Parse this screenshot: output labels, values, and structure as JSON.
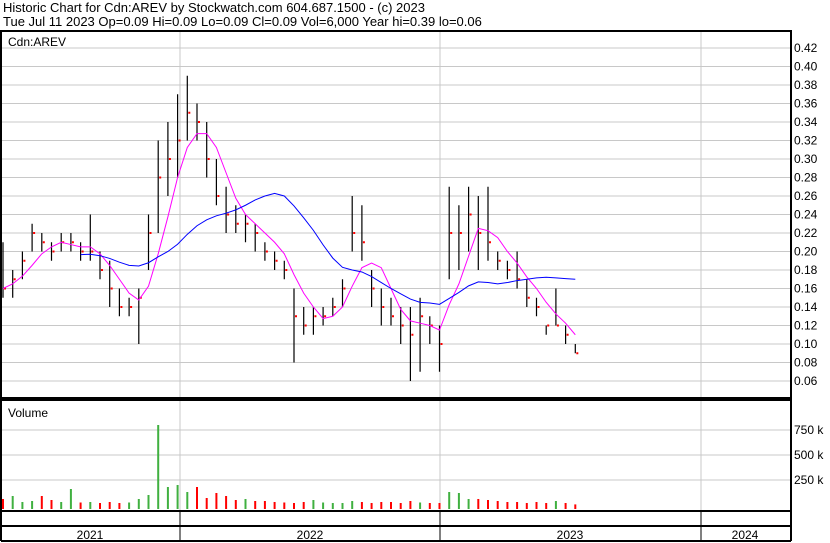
{
  "header": {
    "line1": "Historic Chart for Cdn:AREV by Stockwatch.com 604.687.1500 - (c) 2023",
    "line2": "Tue Jul 11 2023  Op=0.09  Hi=0.09  Lo=0.09  Cl=0.09  Vol=6,000  Year hi=0.39  lo=0.06"
  },
  "chart_data": {
    "type": "line",
    "title": "Cdn:AREV",
    "volume_label": "Volume",
    "price_ticks": [
      "0.42",
      "0.40",
      "0.38",
      "0.36",
      "0.34",
      "0.32",
      "0.30",
      "0.28",
      "0.26",
      "0.24",
      "0.22",
      "0.20",
      "0.18",
      "0.16",
      "0.14",
      "0.12",
      "0.10",
      "0.08",
      "0.06"
    ],
    "ylim": [
      0.045,
      0.435
    ],
    "volume_ticks": [
      "750 k",
      "500 k",
      "250 k"
    ],
    "years": [
      "2021",
      "2022",
      "2023",
      "2024"
    ],
    "bars": [
      [
        0.21,
        0.15,
        0.16
      ],
      [
        0.18,
        0.15,
        0.17
      ],
      [
        0.2,
        0.17,
        0.19
      ],
      [
        0.23,
        0.2,
        0.22
      ],
      [
        0.22,
        0.2,
        0.21
      ],
      [
        0.21,
        0.19,
        0.2
      ],
      [
        0.22,
        0.2,
        0.21
      ],
      [
        0.22,
        0.2,
        0.21
      ],
      [
        0.21,
        0.19,
        0.2
      ],
      [
        0.24,
        0.19,
        0.2
      ],
      [
        0.2,
        0.17,
        0.18
      ],
      [
        0.19,
        0.14,
        0.16
      ],
      [
        0.16,
        0.13,
        0.14
      ],
      [
        0.15,
        0.13,
        0.14
      ],
      [
        0.16,
        0.1,
        0.15
      ],
      [
        0.24,
        0.18,
        0.22
      ],
      [
        0.32,
        0.22,
        0.28
      ],
      [
        0.34,
        0.26,
        0.3
      ],
      [
        0.37,
        0.28,
        0.32
      ],
      [
        0.39,
        0.32,
        0.35
      ],
      [
        0.36,
        0.32,
        0.34
      ],
      [
        0.34,
        0.28,
        0.3
      ],
      [
        0.3,
        0.25,
        0.26
      ],
      [
        0.27,
        0.22,
        0.24
      ],
      [
        0.25,
        0.22,
        0.23
      ],
      [
        0.24,
        0.21,
        0.23
      ],
      [
        0.23,
        0.2,
        0.22
      ],
      [
        0.21,
        0.19,
        0.2
      ],
      [
        0.2,
        0.18,
        0.19
      ],
      [
        0.19,
        0.17,
        0.18
      ],
      [
        0.16,
        0.08,
        0.13
      ],
      [
        0.14,
        0.11,
        0.12
      ],
      [
        0.14,
        0.11,
        0.13
      ],
      [
        0.14,
        0.12,
        0.13
      ],
      [
        0.15,
        0.13,
        0.14
      ],
      [
        0.17,
        0.14,
        0.16
      ],
      [
        0.26,
        0.2,
        0.22
      ],
      [
        0.25,
        0.19,
        0.21
      ],
      [
        0.18,
        0.14,
        0.16
      ],
      [
        0.16,
        0.12,
        0.14
      ],
      [
        0.15,
        0.12,
        0.13
      ],
      [
        0.14,
        0.1,
        0.12
      ],
      [
        0.14,
        0.06,
        0.11
      ],
      [
        0.15,
        0.07,
        0.13
      ],
      [
        0.13,
        0.1,
        0.12
      ],
      [
        0.12,
        0.07,
        0.1
      ],
      [
        0.27,
        0.17,
        0.22
      ],
      [
        0.25,
        0.18,
        0.22
      ],
      [
        0.27,
        0.2,
        0.24
      ],
      [
        0.26,
        0.18,
        0.22
      ],
      [
        0.27,
        0.19,
        0.21
      ],
      [
        0.2,
        0.18,
        0.19
      ],
      [
        0.19,
        0.17,
        0.18
      ],
      [
        0.2,
        0.16,
        0.17
      ],
      [
        0.17,
        0.14,
        0.15
      ],
      [
        0.15,
        0.13,
        0.14
      ],
      [
        0.12,
        0.11,
        0.12
      ],
      [
        0.16,
        0.12,
        0.12
      ],
      [
        0.12,
        0.1,
        0.11
      ],
      [
        0.1,
        0.09,
        0.09
      ]
    ],
    "volume_k": [
      60,
      90,
      30,
      40,
      90,
      50,
      30,
      160,
      25,
      30,
      20,
      30,
      20,
      25,
      60,
      100,
      800,
      180,
      200,
      130,
      180,
      70,
      120,
      90,
      50,
      60,
      40,
      40,
      30,
      25,
      20,
      30,
      50,
      25,
      20,
      20,
      40,
      30,
      20,
      30,
      30,
      20,
      40,
      25,
      20,
      20,
      130,
      120,
      60,
      60,
      50,
      40,
      30,
      30,
      20,
      30,
      20,
      40,
      20,
      6
    ],
    "volume_ylim": [
      0,
      960
    ],
    "colors": {
      "up": "#40b040",
      "down": "#ff0000",
      "ma_short": "#ff00ff",
      "ma_long": "#0000ff",
      "grid": "#c8c8c8"
    }
  }
}
